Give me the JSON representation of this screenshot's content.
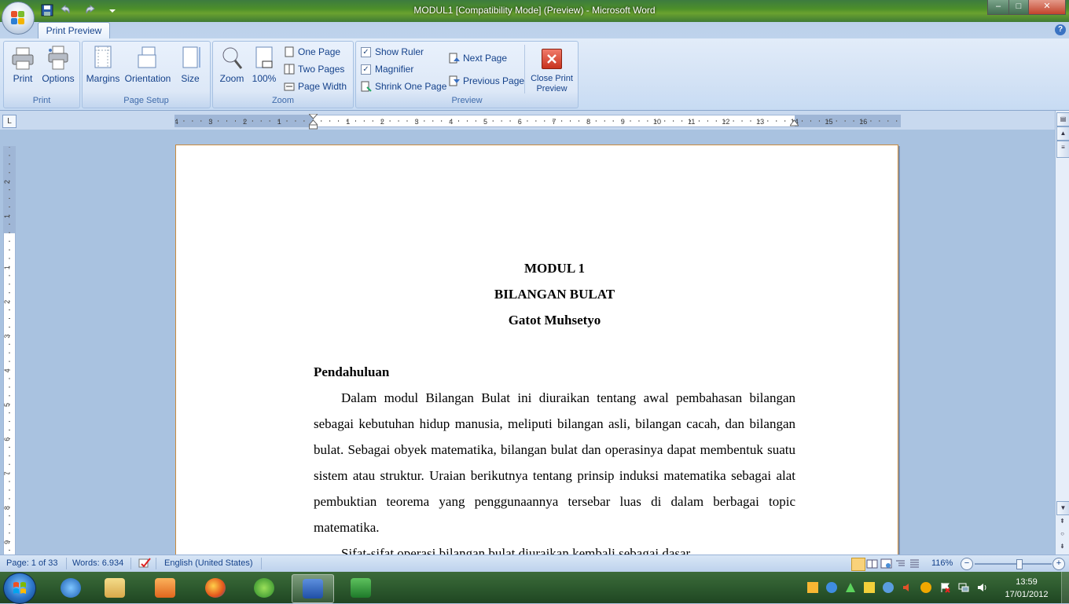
{
  "window": {
    "title": "MODUL1 [Compatibility Mode] (Preview) - Microsoft Word",
    "controls": {
      "minimize": "–",
      "maximize": "□",
      "close": "✕"
    }
  },
  "ribbon": {
    "active_tab": "Print Preview",
    "help": "?",
    "groups": {
      "print": {
        "label": "Print",
        "print_btn": "Print",
        "options_btn": "Options"
      },
      "page_setup": {
        "label": "Page Setup",
        "margins": "Margins",
        "orientation": "Orientation",
        "size": "Size"
      },
      "zoom": {
        "label": "Zoom",
        "zoom_btn": "Zoom",
        "hundred_btn": "100%",
        "one_page": "One Page",
        "two_pages": "Two Pages",
        "page_width": "Page Width"
      },
      "preview": {
        "label": "Preview",
        "show_ruler": "Show Ruler",
        "magnifier": "Magnifier",
        "shrink_one_page": "Shrink One Page",
        "next_page": "Next Page",
        "previous_page": "Previous Page",
        "close_line1": "Close Print",
        "close_line2": "Preview",
        "show_ruler_checked": true,
        "magnifier_checked": true
      }
    }
  },
  "ruler": {
    "corner": "L",
    "h_ticks": [
      "4",
      "3",
      "2",
      "1",
      "1",
      "2",
      "3",
      "4",
      "5",
      "6",
      "7",
      "8",
      "9",
      "10",
      "11",
      "12",
      "13",
      "14",
      "15",
      "16"
    ],
    "v_ticks": [
      "2",
      "1",
      "1",
      "2",
      "3",
      "4",
      "5",
      "6",
      "7",
      "8",
      "9"
    ]
  },
  "document": {
    "title1": "MODUL 1",
    "title2": "BILANGAN BULAT",
    "author": "Gatot Muhsetyo",
    "heading": "Pendahuluan",
    "para1": "Dalam modul Bilangan Bulat ini diuraikan tentang awal pembahasan bilangan sebagai kebutuhan hidup manusia, meliputi bilangan asli, bilangan cacah, dan bilangan bulat. Sebagai obyek matematika, bilangan bulat dan operasinya dapat membentuk suatu sistem atau struktur. Uraian berikutnya tentang prinsip induksi matematika sebagai alat pembuktian teorema yang penggunaannya tersebar luas di dalam berbagai topic matematika.",
    "para2": "Sifat-sifat operasi bilangan bulat diuraikan kembali sebagai dasar"
  },
  "statusbar": {
    "page": "Page: 1 of 33",
    "words": "Words: 6.934",
    "language": "English (United States)",
    "zoom": "116%",
    "zoom_fraction": 0.58
  },
  "taskbar": {
    "time": "13:59",
    "date": "17/01/2012"
  }
}
